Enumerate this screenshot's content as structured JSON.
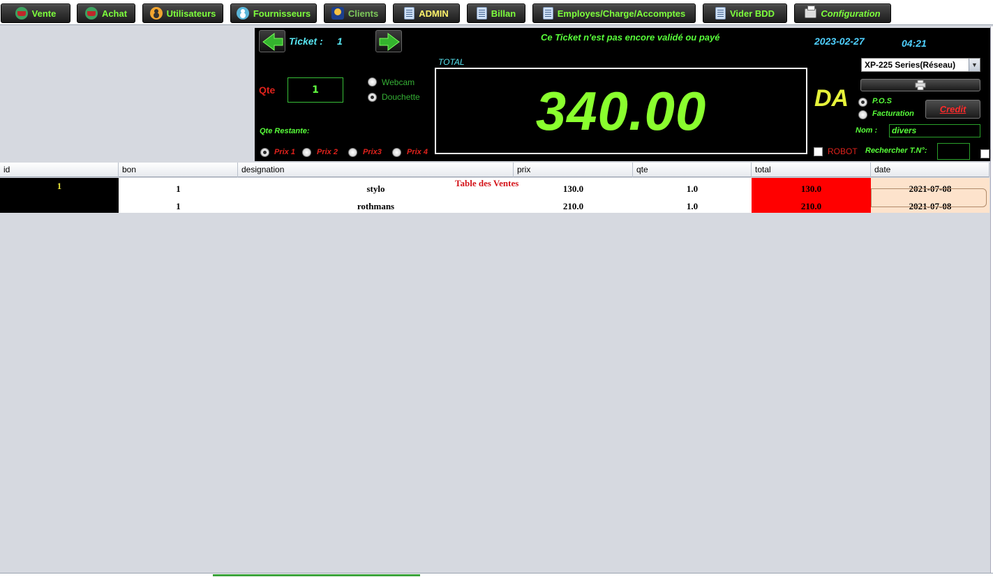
{
  "nav": [
    {
      "label": "Vente",
      "icon": "basket-icon",
      "style": ""
    },
    {
      "label": "Achat",
      "icon": "basket-icon",
      "style": ""
    },
    {
      "label": "Utilisateurs",
      "icon": "user-icon",
      "style": ""
    },
    {
      "label": "Fournisseurs",
      "icon": "supplier-icon",
      "style": ""
    },
    {
      "label": "Clients",
      "icon": "client-icon",
      "style": "dim"
    },
    {
      "label": "ADMIN",
      "icon": "document-icon",
      "style": "yellow"
    },
    {
      "label": "Billan",
      "icon": "document-icon",
      "style": ""
    },
    {
      "label": "Employes/Charge/Accomptes",
      "icon": "document-icon",
      "style": ""
    },
    {
      "label": "Vider BDD",
      "icon": "document-icon",
      "style": ""
    },
    {
      "label": "Configuration",
      "icon": "printer-icon",
      "style": "italic"
    }
  ],
  "ticket": {
    "label": "Ticket :",
    "number": "1",
    "status": "Ce Ticket n'est pas encore validé ou payé",
    "date": "2023-02-27",
    "time": "04:21"
  },
  "qty": {
    "label": "Qte",
    "value": "1",
    "remaining_label": "Qte Restante:"
  },
  "scan_modes": {
    "webcam": "Webcam",
    "douchette": "Douchette",
    "selected": "douchette"
  },
  "prices": [
    "Prix 1",
    "Prix 2",
    "Prix3",
    "Prix 4"
  ],
  "total": {
    "label": "TOTAL",
    "value": "340.00",
    "currency": "DA"
  },
  "printer": {
    "selected": "XP-225 Series(Réseau)"
  },
  "mode": {
    "pos": "P.O.S",
    "facturation": "Facturation",
    "selected": "pos"
  },
  "credit_label": "Credit",
  "nom": {
    "label": "Nom :",
    "value": "divers"
  },
  "robot_label": "ROBOT",
  "search_label": "Rechercher  T.N°:",
  "table": {
    "caption": "Table des Ventes",
    "columns": [
      "id",
      "bon",
      "designation",
      "prix",
      "qte",
      "total",
      "date"
    ],
    "rows": [
      {
        "id": "1",
        "bon": "1",
        "designation": "stylo",
        "prix": "130.0",
        "qte": "1.0",
        "total": "130.0",
        "date": "2021-07-08"
      },
      {
        "id": "",
        "bon": "1",
        "designation": "rothmans",
        "prix": "210.0",
        "qte": "1.0",
        "total": "210.0",
        "date": "2021-07-08"
      }
    ]
  },
  "colors": {
    "accent_green": "#58ff3a",
    "total_green": "#8aff2e",
    "total_cell": "#ff0000",
    "date_cell": "#fde3cc"
  }
}
